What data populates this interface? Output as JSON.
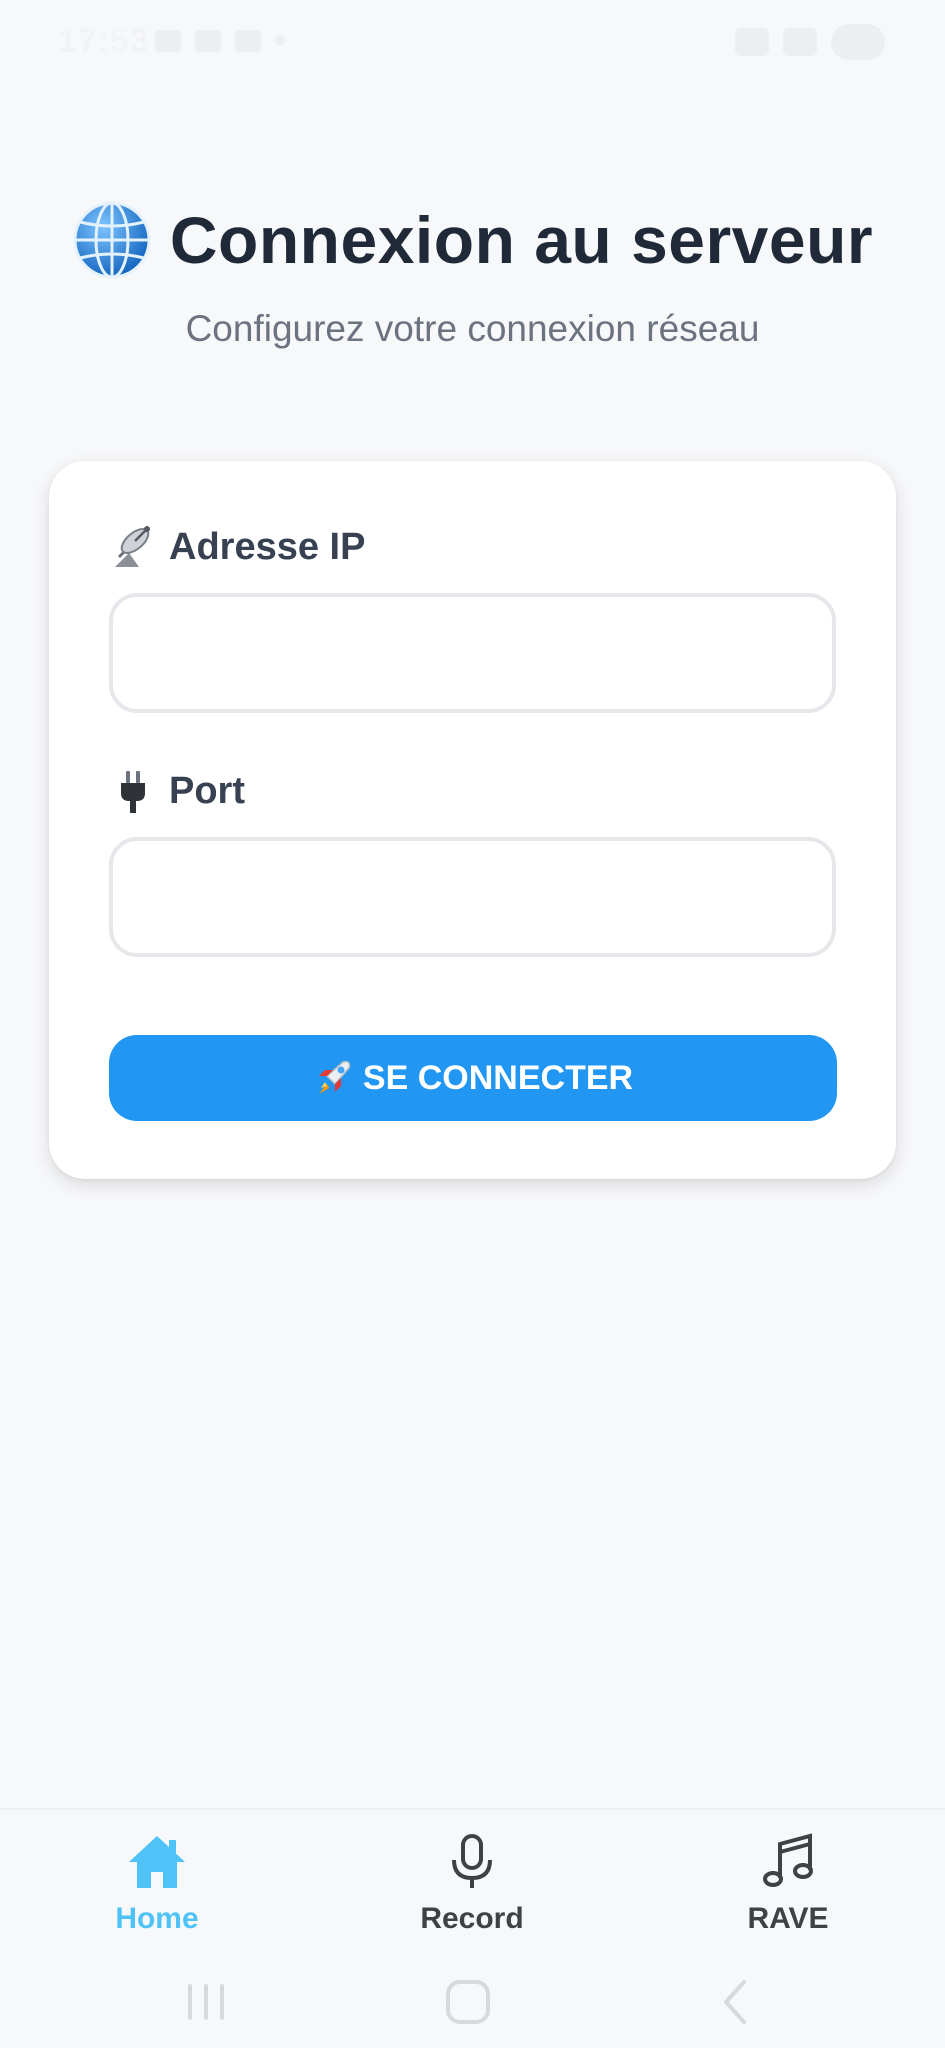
{
  "status_bar": {
    "time": "17:53"
  },
  "header": {
    "title": "Connexion au serveur",
    "subtitle": "Configurez votre connexion réseau",
    "title_icon": "globe-icon"
  },
  "form": {
    "ip": {
      "label": "Adresse IP",
      "icon": "satellite-dish-icon",
      "value": "",
      "placeholder": ""
    },
    "port": {
      "label": "Port",
      "icon": "electric-plug-icon",
      "value": "",
      "placeholder": ""
    },
    "connect_button": {
      "label": "SE CONNECTER",
      "icon": "rocket-icon",
      "color": "#2196f3"
    }
  },
  "bottom_nav": {
    "items": [
      {
        "label": "Home",
        "icon": "home-icon",
        "active": true
      },
      {
        "label": "Record",
        "icon": "microphone-icon",
        "active": false
      },
      {
        "label": "RAVE",
        "icon": "music-note-icon",
        "active": false
      }
    ],
    "active_color": "#4fc3f7"
  },
  "system_nav": {
    "buttons": [
      "recent-apps-icon",
      "home-circle-icon",
      "back-icon"
    ]
  }
}
